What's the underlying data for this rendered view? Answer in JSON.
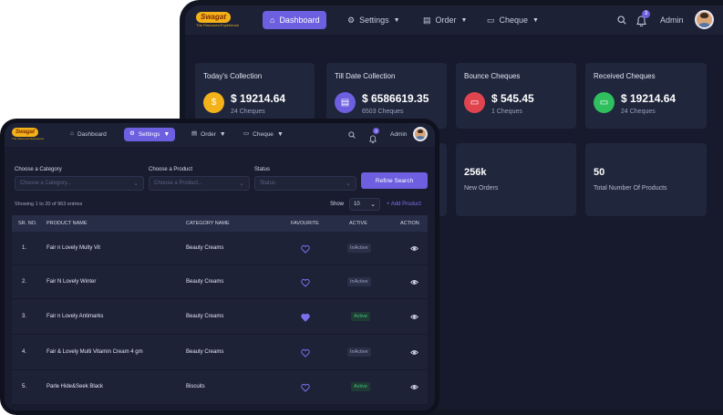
{
  "brand": {
    "name": "Swagat",
    "tagline": "The Flavoured Experience",
    "accent": "#6c5fe0",
    "logo_color": "#f4b21a"
  },
  "nav": {
    "dashboard": "Dashboard",
    "settings": "Settings",
    "order": "Order",
    "cheque": "Cheque",
    "user": "Admin",
    "notifications": "3"
  },
  "dashboard": {
    "stats": [
      {
        "title": "Today's Collection",
        "value": "$ 19214.64",
        "sub": "24 Cheques",
        "color": "#f4b21a"
      },
      {
        "title": "Till Date Collection",
        "value": "$ 6586619.35",
        "sub": "6503 Cheques",
        "color": "#6c5fe0"
      },
      {
        "title": "Bounce Cheques",
        "value": "$ 545.45",
        "sub": "1 Cheques",
        "color": "#e0454f"
      },
      {
        "title": "Received Cheques",
        "value": "$ 19214.64",
        "sub": "24 Cheques",
        "color": "#2fbf5f"
      }
    ],
    "totals": [
      {
        "value": "256k",
        "label": "New Orders"
      },
      {
        "value": "50",
        "label": "Total Number Of Products"
      }
    ]
  },
  "filters": {
    "category_label": "Choose a Category",
    "category_placeholder": "Choose a Category...",
    "product_label": "Choose a Product",
    "product_placeholder": "Choose a Product...",
    "status_label": "Status",
    "status_placeholder": "Status",
    "refine_button": "Refine Search"
  },
  "table_meta": {
    "entries": "Showing 1 to 20 of 963 entries",
    "show_label": "Show",
    "show_value": "10",
    "add_product": "+ Add Product"
  },
  "table": {
    "headers": [
      "SR. NO.",
      "PRODUCT NAME",
      "CATEGORY NAME",
      "FAVOURITE",
      "ACTIVE",
      "ACTION"
    ],
    "rows": [
      {
        "sr": "1.",
        "product": "Fair n Lovely Multy Vit",
        "category": "Beauty Creams",
        "favourite": false,
        "status": "InActive"
      },
      {
        "sr": "2.",
        "product": "Fair N Lovely Winter",
        "category": "Beauty Creams",
        "favourite": false,
        "status": "InActive"
      },
      {
        "sr": "3.",
        "product": "Fair n Lovely Antimarks",
        "category": "Beauty Creams",
        "favourite": true,
        "status": "Active"
      },
      {
        "sr": "4.",
        "product": "Fair & Lovely Multi Vitamin Cream 4 gm",
        "category": "Beauty Creams",
        "favourite": false,
        "status": "InActive"
      },
      {
        "sr": "5.",
        "product": "Parle Hide&Seek Black",
        "category": "Biscuits",
        "favourite": false,
        "status": "Active"
      }
    ]
  }
}
